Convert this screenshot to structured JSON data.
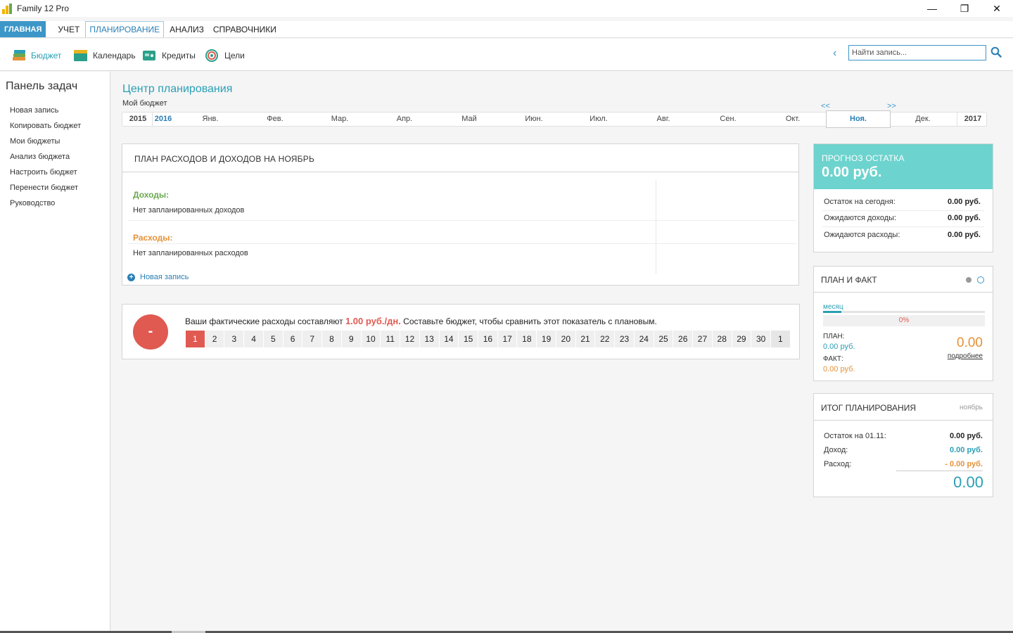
{
  "app": {
    "title": "Family 12 Pro",
    "window_controls": [
      "—",
      "❐",
      "✕"
    ]
  },
  "menu": {
    "items": [
      "ГЛАВНАЯ",
      "УЧЕТ",
      "ПЛАНИРОВАНИЕ",
      "АНАЛИЗ",
      "СПРАВОЧНИКИ"
    ],
    "active": "ПЛАНИРОВАНИЕ"
  },
  "toolbar": {
    "items": [
      {
        "label": "Бюджет",
        "icon": "budget-stack-icon"
      },
      {
        "label": "Календарь",
        "icon": "calendar-icon"
      },
      {
        "label": "Кредиты",
        "icon": "credits-icon"
      },
      {
        "label": "Цели",
        "icon": "target-icon"
      }
    ],
    "back_glyph": "‹",
    "search_placeholder": "Найти запись..."
  },
  "sidebar": {
    "title": "Панель задач",
    "items": [
      "Новая запись",
      "Копировать бюджет",
      "Мои бюджеты",
      "Анализ бюджета",
      "Настроить бюджет",
      "Перенести бюджет",
      "Руководство"
    ]
  },
  "main": {
    "title": "Центр планирования",
    "subtitle": "Мой бюджет",
    "nav_prev": "<<",
    "nav_next": ">>",
    "timeline": {
      "year_prev": "2015",
      "year_cur": "2016",
      "months": [
        "Янв.",
        "Фев.",
        "Мар.",
        "Апр.",
        "Май",
        "Июн.",
        "Июл.",
        "Авг.",
        "Сен.",
        "Окт.",
        "Ноя.",
        "Дек."
      ],
      "active_month": "Ноя.",
      "year_next": "2017"
    },
    "plan": {
      "header": "ПЛАН РАСХОДОВ И ДОХОДОВ НА НОЯБРЬ",
      "income_label": "Доходы:",
      "income_empty": "Нет запланированных доходов",
      "expense_label": "Расходы:",
      "expense_empty": "Нет запланированных расходов",
      "new_entry": "Новая запись"
    },
    "days": {
      "badge": "-",
      "msg_before": "Ваши фактические расходы составляют ",
      "msg_value": "1.00 руб./дн.",
      "msg_after": " Составьте бюджет, чтобы сравнить этот показатель с плановым.",
      "items": [
        "1",
        "2",
        "3",
        "4",
        "5",
        "6",
        "7",
        "8",
        "9",
        "10",
        "11",
        "12",
        "13",
        "14",
        "15",
        "16",
        "17",
        "18",
        "19",
        "20",
        "21",
        "22",
        "23",
        "24",
        "25",
        "26",
        "27",
        "28",
        "29",
        "30",
        "1"
      ],
      "today": "1"
    }
  },
  "forecast": {
    "label": "ПРОГНОЗ ОСТАТКА",
    "value": "0.00 руб.",
    "rows": [
      {
        "k": "Остаток на сегодня:",
        "v": "0.00 руб."
      },
      {
        "k": "Ожидаются доходы:",
        "v": "0.00 руб."
      },
      {
        "k": "Ожидаются расходы:",
        "v": "0.00 руб."
      }
    ]
  },
  "planfact": {
    "header": "ПЛАН И ФАКТ",
    "tab": "месяц",
    "percent": "0%",
    "plan_label": "ПЛАН:",
    "plan_value": "0.00 руб.",
    "fact_label": "ФАКТ:",
    "fact_value": "0.00 руб.",
    "big_value": "0.00",
    "more_link": "подробнее"
  },
  "itog": {
    "header": "ИТОГ ПЛАНИРОВАНИЯ",
    "month": "ноябрь",
    "rows": [
      {
        "k": "Остаток на 01.11:",
        "v": "0.00 руб."
      },
      {
        "k": "Доход:",
        "v": "0.00 руб."
      },
      {
        "k": "Расход:",
        "v": "- 0.00 руб."
      }
    ],
    "total": "0.00"
  },
  "colors": {
    "accent": "#2a9fb5",
    "brand_blue": "#3c96c8",
    "forecast_bg": "#6dd3ce",
    "income": "#6aa84f",
    "expense": "#e69138",
    "alert": "#e05a52"
  }
}
